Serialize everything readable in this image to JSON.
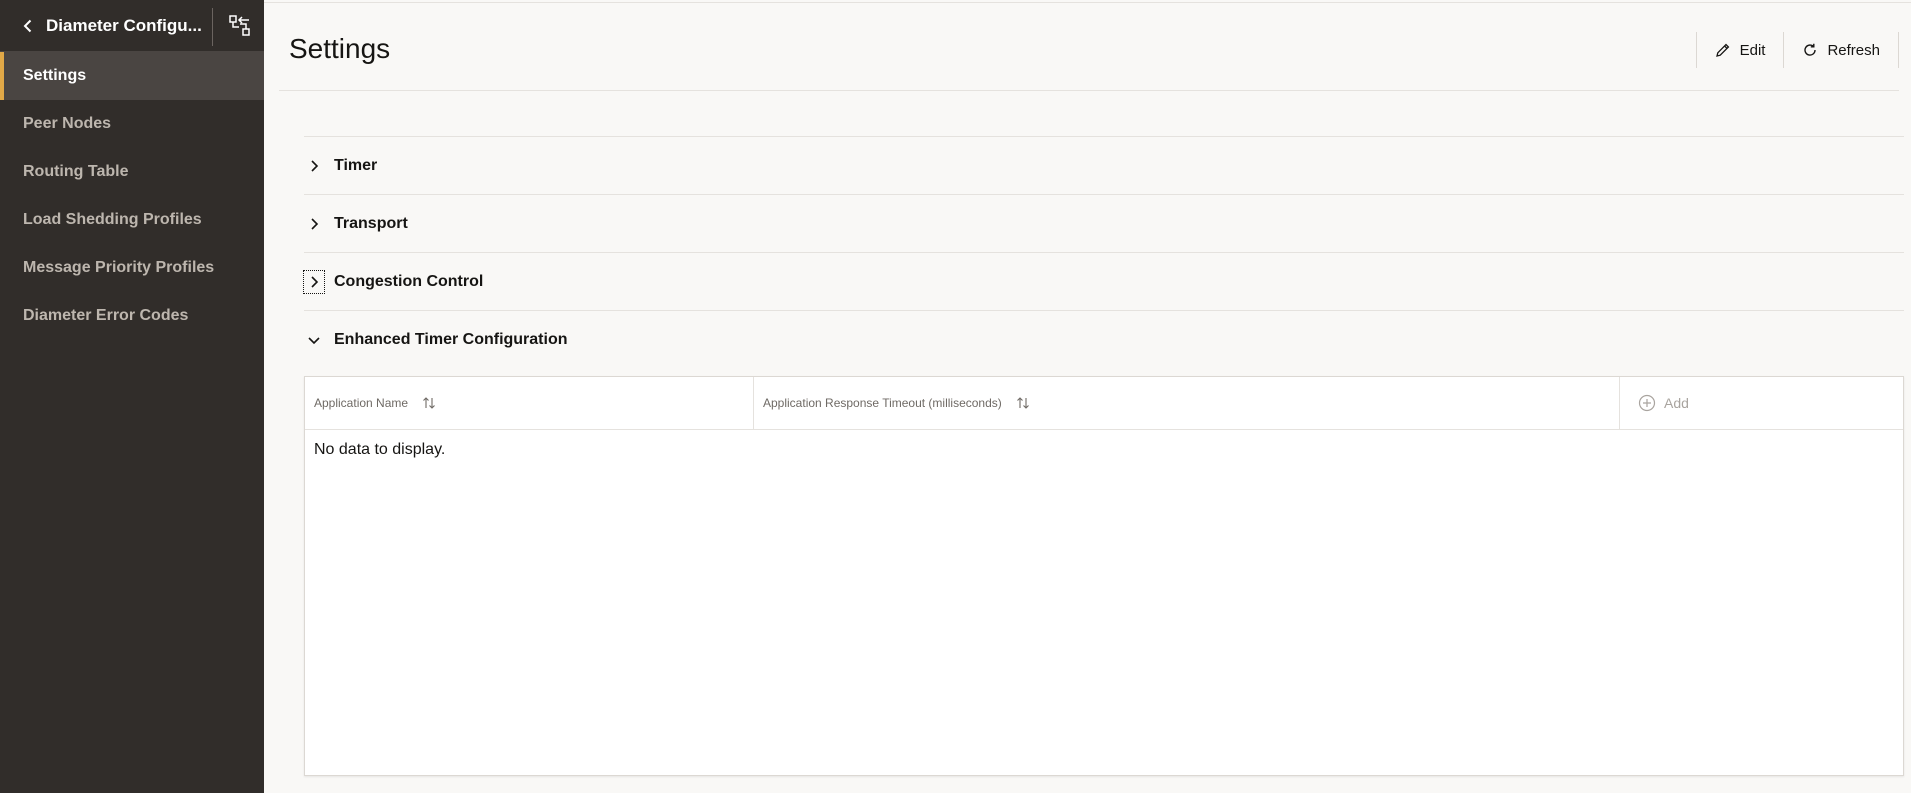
{
  "sidebar": {
    "back_title": "Diameter Configu...",
    "items": [
      {
        "label": "Settings",
        "active": true
      },
      {
        "label": "Peer Nodes"
      },
      {
        "label": "Routing Table"
      },
      {
        "label": "Load Shedding Profiles"
      },
      {
        "label": "Message Priority Profiles"
      },
      {
        "label": "Diameter Error Codes"
      }
    ]
  },
  "header": {
    "title": "Settings",
    "edit_label": "Edit",
    "refresh_label": "Refresh"
  },
  "sections": [
    {
      "label": "Timer",
      "expanded": false
    },
    {
      "label": "Transport",
      "expanded": false
    },
    {
      "label": "Congestion Control",
      "expanded": false
    },
    {
      "label": "Enhanced Timer Configuration",
      "expanded": true
    }
  ],
  "table": {
    "columns": [
      "Application Name",
      "Application Response Timeout (milliseconds)"
    ],
    "add_label": "Add",
    "empty_message": "No data to display."
  },
  "colors": {
    "sidebar_bg": "#312d2a",
    "active_accent": "#e0a847",
    "page_bg": "#f9f8f6"
  }
}
